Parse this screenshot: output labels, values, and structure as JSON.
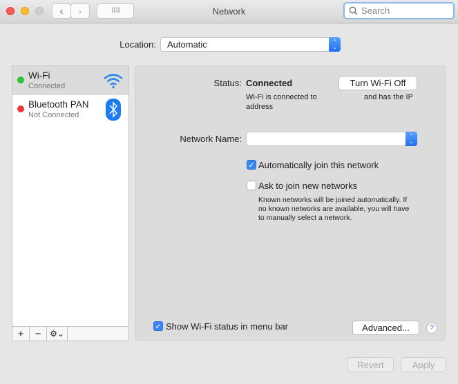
{
  "window": {
    "title": "Network",
    "search_placeholder": "Search"
  },
  "toolbar": {
    "back_icon": "chevron-left",
    "forward_icon": "chevron-right",
    "grid_icon": "grid"
  },
  "location": {
    "label": "Location:",
    "value": "Automatic"
  },
  "services": [
    {
      "name": "Wi-Fi",
      "status": "Connected",
      "status_color": "#2fc13b",
      "icon": "wifi-icon",
      "selected": true
    },
    {
      "name": "Bluetooth PAN",
      "status": "Not Connected",
      "status_color": "#f0353a",
      "icon": "bluetooth-icon",
      "selected": false
    }
  ],
  "sidebar_actions": {
    "add": "+",
    "remove": "−",
    "gear": "⚙⌄"
  },
  "detail": {
    "status_label": "Status:",
    "status_value": "Connected",
    "toggle_button": "Turn Wi-Fi Off",
    "desc_line1a": "Wi-Fi is connected to",
    "desc_line1b": "and has the IP",
    "desc_line2": "address",
    "network_name_label": "Network Name:",
    "network_name_value": "",
    "auto_join": {
      "label": "Automatically join this network",
      "checked": true
    },
    "ask_join": {
      "label": "Ask to join new networks",
      "checked": false
    },
    "help_text": [
      "Known networks will be joined automatically. If",
      "no known networks are available, you will have",
      "to manually select a network."
    ],
    "show_status": {
      "label": "Show Wi-Fi status in menu bar",
      "checked": true
    },
    "advanced_button": "Advanced...",
    "help_button": "?"
  },
  "footer": {
    "revert": "Revert",
    "apply": "Apply"
  },
  "colors": {
    "accent": "#3b86f7"
  }
}
